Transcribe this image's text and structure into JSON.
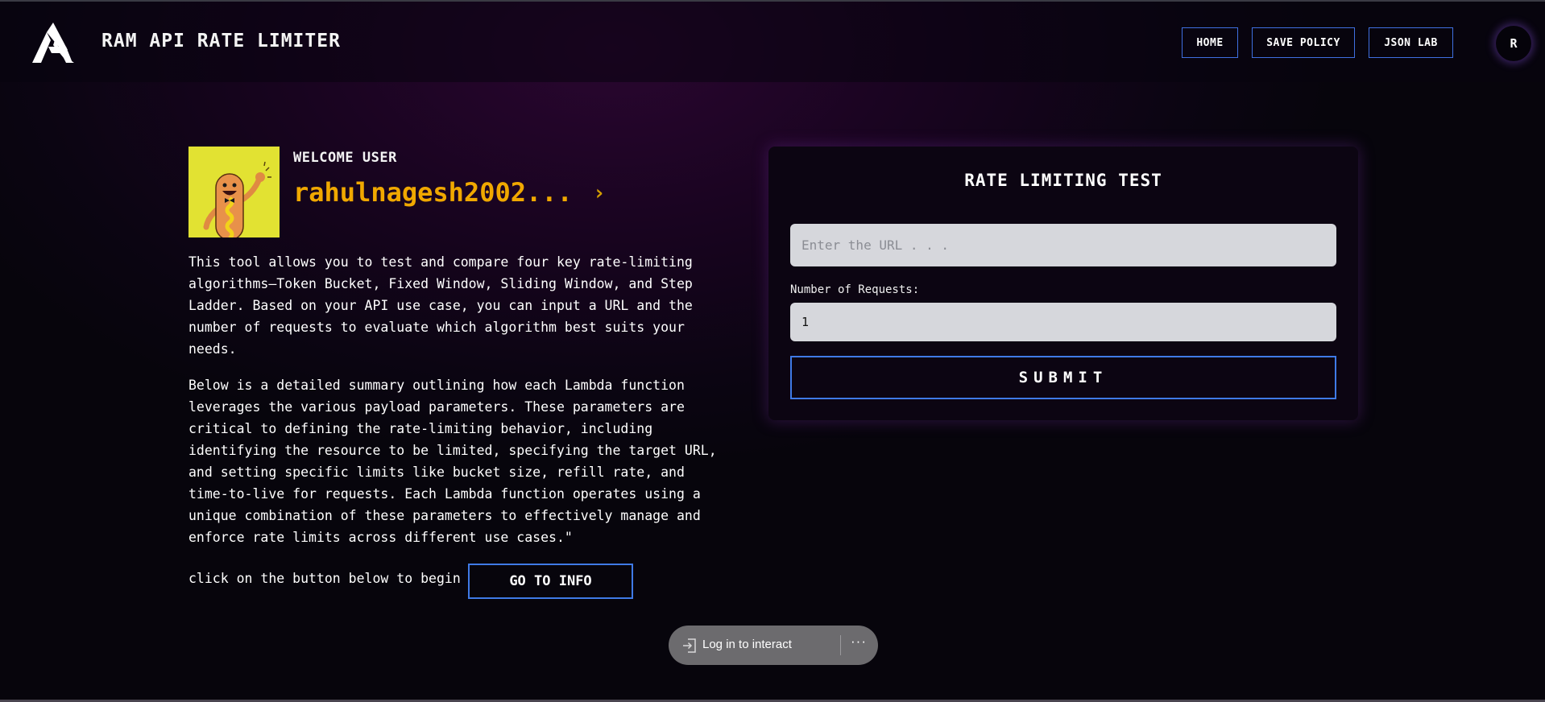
{
  "app": {
    "title": "RAM API RATE LIMITER",
    "logo_icon": "ra-monogram-logo"
  },
  "nav": {
    "items": [
      {
        "label": "HOME"
      },
      {
        "label": "SAVE POLICY"
      },
      {
        "label": "JSON LAB"
      }
    ],
    "avatar_initial": "R"
  },
  "profile": {
    "welcome": "WELCOME USER",
    "username": "rahulnagesh2002...",
    "chevron": "›",
    "image_icon": "hotdog-character-avatar"
  },
  "intro": {
    "paragraph1": "This tool allows you to test and compare four key rate-limiting algorithms—Token Bucket, Fixed Window, Sliding Window, and Step Ladder. Based on your API use case, you can input a URL and the number of requests to evaluate which algorithm best suits your needs.",
    "paragraph2": "Below is a detailed summary outlining how each Lambda function leverages the various payload parameters. These parameters are critical to defining the rate-limiting behavior, including identifying the resource to be limited, specifying the target URL, and setting specific limits like bucket size, refill rate, and time-to-live for requests. Each Lambda function operates using a unique combination of these parameters to effectively manage and enforce rate limits across different use cases.\"",
    "cta_text": "click on the button below to begin",
    "cta_button": "GO TO INFO"
  },
  "test_card": {
    "title": "RATE LIMITING TEST",
    "url_placeholder": "Enter the URL . . .",
    "url_value": "",
    "requests_label": "Number of Requests:",
    "requests_value": "1",
    "submit_label": "SUBMIT"
  },
  "login_bar": {
    "label": "Log in to interact",
    "more": "···"
  },
  "colors": {
    "accent_blue": "#3f7ae6",
    "username_gold": "#f0a800",
    "avatar_yellow": "#e2e232",
    "background": "#0b0512"
  }
}
